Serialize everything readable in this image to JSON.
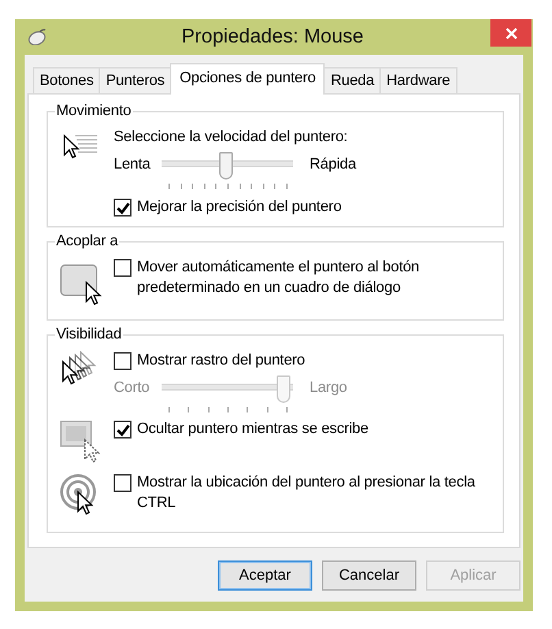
{
  "window": {
    "title": "Propiedades: Mouse"
  },
  "tabs": [
    {
      "label": "Botones",
      "selected": false
    },
    {
      "label": "Punteros",
      "selected": false
    },
    {
      "label": "Opciones de puntero",
      "selected": true
    },
    {
      "label": "Rueda",
      "selected": false
    },
    {
      "label": "Hardware",
      "selected": false
    }
  ],
  "groups": [
    {
      "title": "Movimiento",
      "sections": [
        {
          "items": [
            {
              "kind": "text",
              "text": "Seleccione la velocidad del puntero:"
            },
            {
              "kind": "slider",
              "min_label": "Lenta",
              "max_label": "Rápida",
              "level": 0.5,
              "disabled": false
            },
            {
              "kind": "checkbox",
              "label": "Mejorar la precisión del puntero",
              "checked": true
            }
          ]
        }
      ]
    },
    {
      "title": "Acoplar a",
      "sections": [
        {
          "items": [
            {
              "kind": "checkbox",
              "label": "Mover automáticamente el puntero al botón predeterminado en un cuadro de diálogo",
              "checked": false
            }
          ]
        }
      ]
    },
    {
      "title": "Visibilidad",
      "sections": [
        {
          "items": [
            {
              "kind": "checkbox",
              "label": "Mostrar rastro del puntero",
              "checked": false
            },
            {
              "kind": "slider",
              "min_label": "Corto",
              "max_label": "Largo",
              "level": 1,
              "disabled": true
            }
          ]
        },
        {
          "items": [
            {
              "kind": "checkbox",
              "label": "Ocultar puntero mientras se escribe",
              "checked": true
            }
          ]
        },
        {
          "items": [
            {
              "kind": "checkbox",
              "label": "Mostrar la ubicación del puntero al presionar la tecla CTRL",
              "checked": false
            }
          ]
        }
      ]
    }
  ],
  "buttons": [
    {
      "label": "Aceptar",
      "default": true,
      "disabled": false
    },
    {
      "label": "Cancelar",
      "default": false,
      "disabled": false
    },
    {
      "label": "Aplicar",
      "default": false,
      "disabled": true
    }
  ]
}
